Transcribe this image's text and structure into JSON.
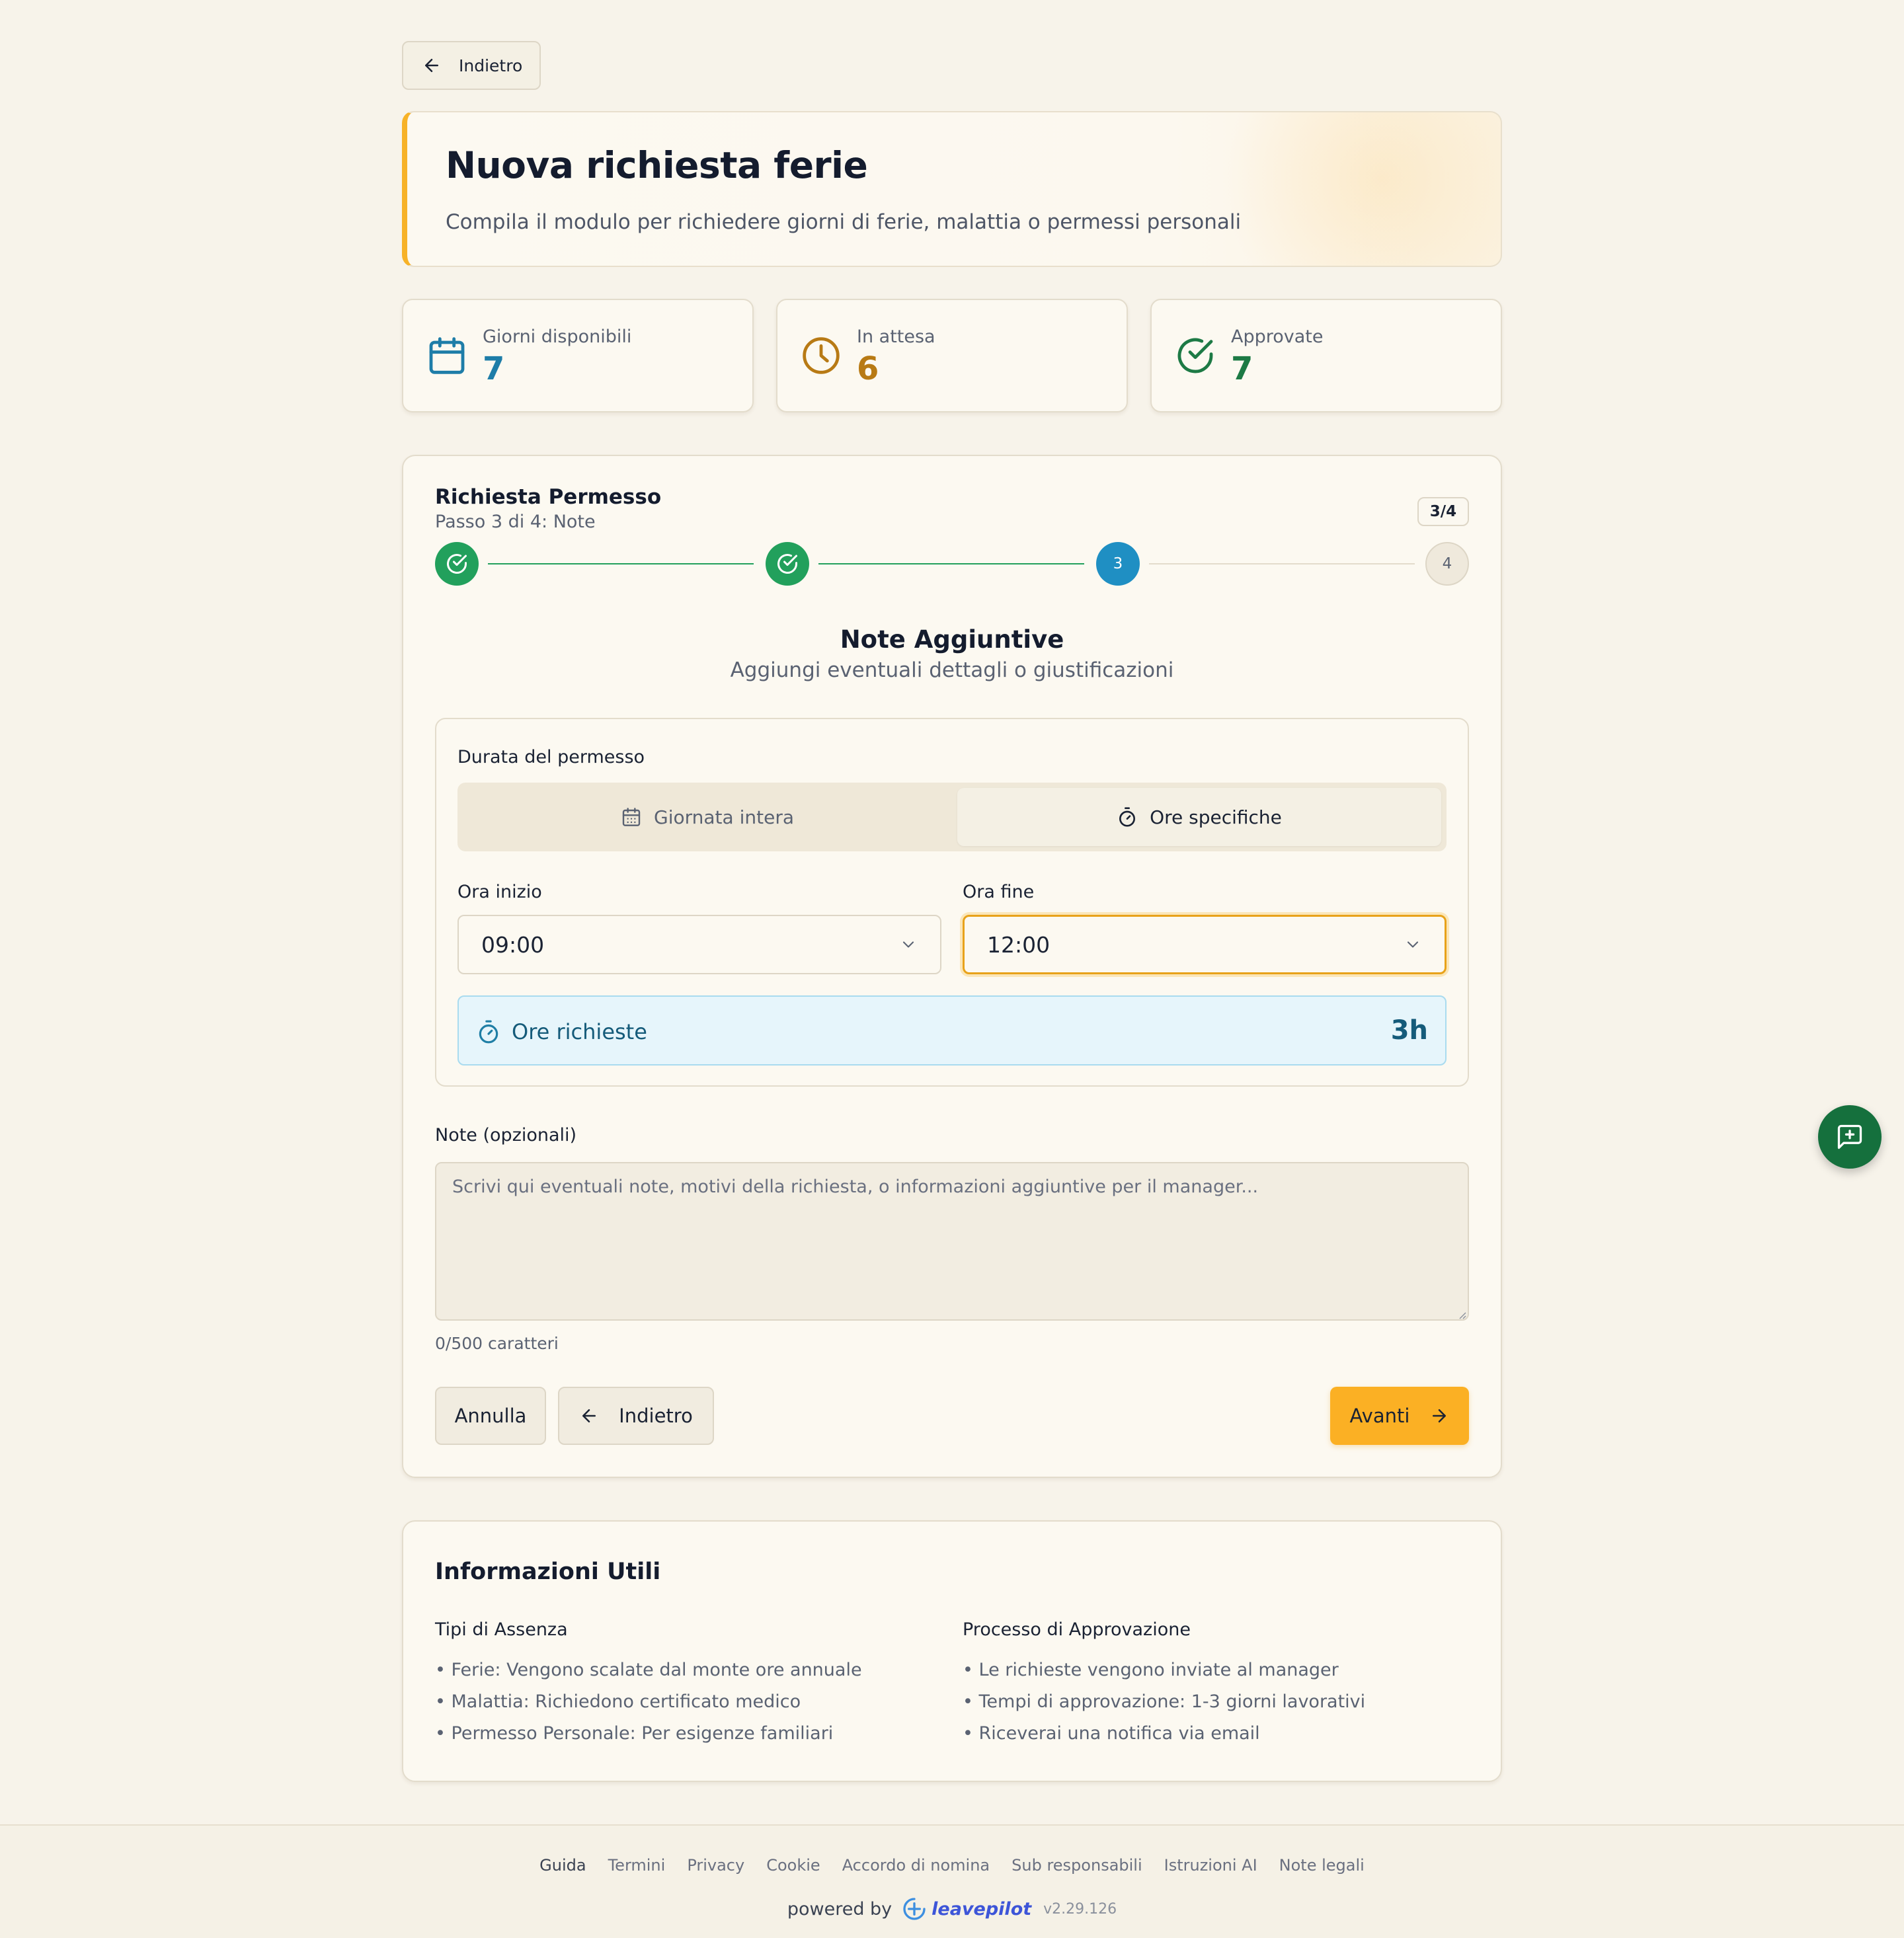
{
  "header": {
    "back_label": "Indietro"
  },
  "hero": {
    "title": "Nuova richiesta ferie",
    "subtitle": "Compila il modulo per richiedere giorni di ferie, malattia o permessi personali"
  },
  "stats": [
    {
      "label": "Giorni disponibili",
      "value": "7",
      "icon": "calendar-icon",
      "color": "#1e7da8"
    },
    {
      "label": "In attesa",
      "value": "6",
      "icon": "clock-icon",
      "color": "#b87a14"
    },
    {
      "label": "Approvate",
      "value": "7",
      "icon": "check-circle-icon",
      "color": "#1d7a45"
    }
  ],
  "wizard": {
    "title": "Richiesta Permesso",
    "subtitle": "Passo 3 di 4: Note",
    "step_badge": "3/4",
    "steps": [
      {
        "state": "done"
      },
      {
        "state": "done"
      },
      {
        "label": "3",
        "state": "active"
      },
      {
        "label": "4",
        "state": "todo"
      }
    ],
    "section_title": "Note Aggiuntive",
    "section_subtitle": "Aggiungi eventuali dettagli o giustificazioni",
    "duration": {
      "label": "Durata del permesso",
      "options": [
        {
          "label": "Giornata intera",
          "icon": "calendar-icon",
          "selected": false
        },
        {
          "label": "Ore specifiche",
          "icon": "timer-icon",
          "selected": true
        }
      ],
      "start": {
        "label": "Ora inizio",
        "value": "09:00"
      },
      "end": {
        "label": "Ora fine",
        "value": "12:00"
      },
      "hours": {
        "label": "Ore richieste",
        "value": "3h"
      }
    },
    "notes": {
      "label": "Note (opzionali)",
      "placeholder": "Scrivi qui eventuali note, motivi della richiesta, o informazioni aggiuntive per il manager...",
      "value": "",
      "counter": "0/500 caratteri"
    },
    "buttons": {
      "cancel": "Annulla",
      "back": "Indietro",
      "next": "Avanti"
    }
  },
  "info": {
    "title": "Informazioni Utili",
    "columns": [
      {
        "heading": "Tipi di Assenza",
        "items": [
          "• Ferie: Vengono scalate dal monte ore annuale",
          "• Malattia: Richiedono certificato medico",
          "• Permesso Personale: Per esigenze familiari"
        ]
      },
      {
        "heading": "Processo di Approvazione",
        "items": [
          "• Le richieste vengono inviate al manager",
          "• Tempi di approvazione: 1-3 giorni lavorativi",
          "• Riceverai una notifica via email"
        ]
      }
    ]
  },
  "footer": {
    "links": [
      "Guida",
      "Termini",
      "Privacy",
      "Cookie",
      "Accordo di nomina",
      "Sub responsabili",
      "Istruzioni AI",
      "Note legali"
    ],
    "powered_by": "powered by",
    "brand": "leavepilot",
    "version": "v2.29.126"
  },
  "colors": {
    "accent": "#fbb024",
    "success": "#22a05c",
    "active_step": "#1f8fc3",
    "fab": "#15703d"
  }
}
